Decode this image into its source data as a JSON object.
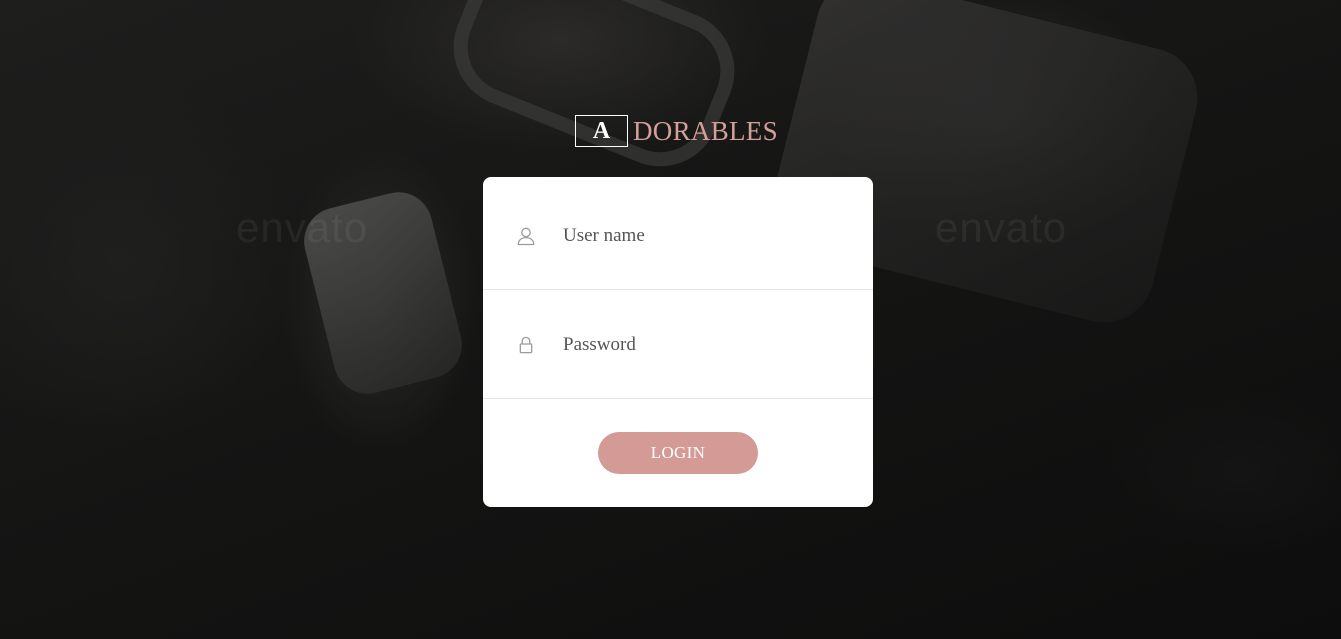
{
  "background": {
    "watermark_text": "envato"
  },
  "logo": {
    "initial": "A",
    "rest": "DORABLES"
  },
  "form": {
    "username": {
      "placeholder": "User name",
      "value": "",
      "icon": "user-icon"
    },
    "password": {
      "placeholder": "Password",
      "value": "",
      "icon": "lock-icon"
    },
    "login_label": "LOGIN"
  },
  "colors": {
    "accent": "#d49a96",
    "logo_text": "#d49f99",
    "card": "#ffffff"
  }
}
